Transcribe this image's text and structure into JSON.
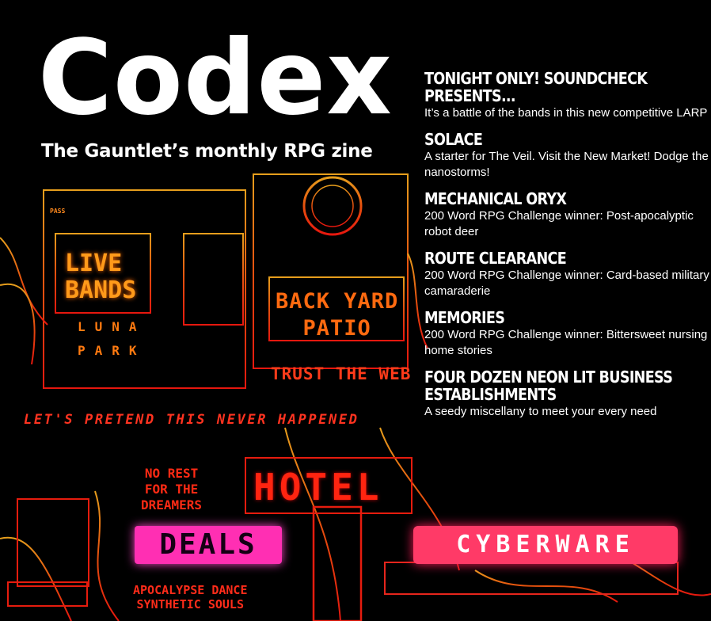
{
  "masthead": {
    "title": "Codex",
    "subtitle": "The Gauntlet’s monthly RPG zine"
  },
  "contents": [
    {
      "headline": "TONIGHT ONLY! SOUNDCHECK PRESENTS...",
      "description": "It’s a battle of the bands in this new competitive LARP"
    },
    {
      "headline": "SOLACE",
      "description": "A starter for The Veil. Visit the New Market! Dodge the nanostorms!"
    },
    {
      "headline": "MECHANICAL ORYX",
      "description": "200 Word RPG Challenge winner: Post-apocalyptic robot deer"
    },
    {
      "headline": "ROUTE CLEARANCE",
      "description": "200 Word RPG Challenge winner: Card-based military camaraderie"
    },
    {
      "headline": "MEMORIES",
      "description": "200 Word RPG Challenge winner: Bittersweet nursing home stories"
    },
    {
      "headline": "FOUR DOZEN NEON LIT BUSINESS ESTABLISHMENTS",
      "description": "A seedy miscellany to meet your every need"
    }
  ],
  "signs": {
    "live_bands": "LIVE\nBANDS",
    "luna_park": "LUNA\nPARK",
    "back_yard_patio": "BACK YARD\nPATIO",
    "trust_the_web": "TRUST THE WEB",
    "pretend": "LET'S PRETEND THIS NEVER HAPPENED",
    "no_rest": "NO REST\nFOR THE\nDREAMERS",
    "hotel": "HOTEL",
    "deals": "DEALS",
    "cyberware": "CYBERWARE",
    "apocalypse": "APOCALYPSE DANCE\nSYNTHETIC SOULS",
    "pass": "PASS"
  },
  "colors": {
    "background": "#000000",
    "text": "#ffffff",
    "neon_orange": "#ff8a1a",
    "neon_red": "#ff2a14",
    "neon_pink": "#ff2fb3",
    "neon_rose": "#ff3a67"
  }
}
